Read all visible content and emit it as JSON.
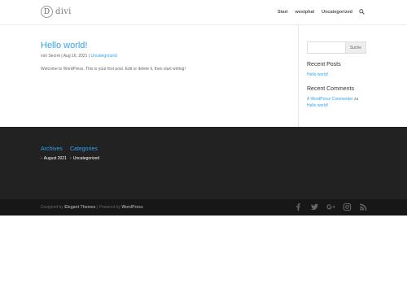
{
  "header": {
    "logo_letter": "D",
    "logo_text": "divi",
    "nav": [
      "Start",
      "westphal",
      "Uncategorized"
    ]
  },
  "post": {
    "title": "Hello world!",
    "meta_prefix": "von",
    "author": "Secret",
    "date": "Aug 16, 2021",
    "category": "Uncategorized",
    "body": "Welcome to WordPress. This is your first post. Edit or delete it, then start writing!"
  },
  "sidebar": {
    "search_button": "Suche",
    "recent_posts_title": "Recent Posts",
    "recent_post": "Hello world!",
    "recent_comments_title": "Recent Comments",
    "comment_author": "A WordPress Commenter",
    "comment_on": "zu",
    "comment_post": "Hello world!"
  },
  "footer": {
    "archives_title": "Archives",
    "archive_item": "August 2021",
    "categories_title": "Categories",
    "category_item": "Uncategorized",
    "credits_prefix": "Designed by",
    "credits_theme": "Elegant Themes",
    "credits_sep": "| Powered by",
    "credits_wp": "WordPress",
    "social_icons": [
      "facebook-icon",
      "twitter-icon",
      "google-plus-icon",
      "instagram-icon",
      "rss-icon"
    ]
  },
  "colors": {
    "accent": "#2ea3f2",
    "footer_bg": "#222222",
    "bottom_bar_bg": "#171717"
  }
}
